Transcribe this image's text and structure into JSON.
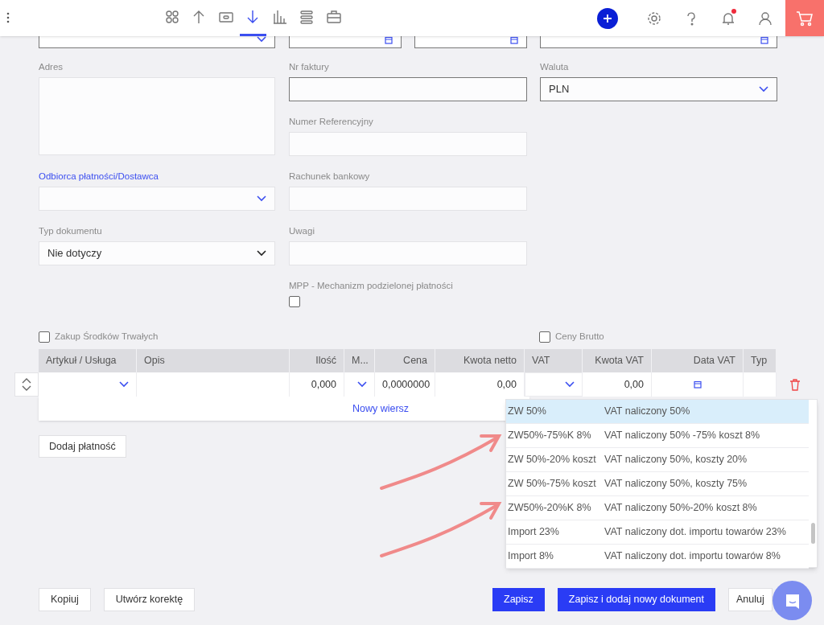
{
  "header": {
    "nav": [
      {
        "selected": false
      },
      {
        "selected": false
      },
      {
        "selected": false
      },
      {
        "selected": true
      },
      {
        "selected": false
      },
      {
        "selected": false
      },
      {
        "selected": false
      }
    ],
    "notification_unread": true
  },
  "top_fields": [
    {
      "kind": "select"
    },
    {
      "kind": "date"
    },
    {
      "kind": "date"
    },
    {
      "kind": "date"
    }
  ],
  "columns": [
    [
      {
        "kind": "textarea",
        "label": "Adres",
        "highlighted": false
      },
      {
        "kind": "select",
        "label": "Odbiorca płatności/Dostawca",
        "highlighted": true
      },
      {
        "kind": "native-select",
        "label": "Typ dokumentu",
        "highlighted": false,
        "value": "Nie dotyczy"
      }
    ],
    [
      {
        "kind": "text",
        "label": "Nr faktury",
        "highlighted": false,
        "outlined": true
      },
      {
        "kind": "text",
        "label": "Numer Referencyjny",
        "highlighted": false,
        "outlined": false
      },
      {
        "kind": "text",
        "label": "Rachunek bankowy",
        "highlighted": false,
        "outlined": false
      },
      {
        "kind": "text",
        "label": "Uwagi",
        "highlighted": false,
        "outlined": false
      },
      {
        "kind": "checkbox",
        "label": "MPP - Mechanizm podzielonej płatności",
        "highlighted": false,
        "checked": false
      }
    ],
    [
      {
        "kind": "select",
        "label": "Waluta",
        "highlighted": false,
        "value": "PLN",
        "outlined": true
      }
    ]
  ],
  "options": [
    {
      "label": "Zakup Środków Trwałych",
      "checked": false
    },
    {
      "label": "Ceny Brutto",
      "checked": false
    }
  ],
  "table": {
    "columns": [
      "Artykuł / Usługa",
      "Opis",
      "Ilość",
      "M...",
      "Cena",
      "Kwota netto",
      "VAT",
      "Kwota VAT",
      "Data VAT",
      "Typ"
    ],
    "rows": [
      {
        "cells": [
          "",
          "",
          "0,000",
          "",
          "0,0000000",
          "0,00",
          "",
          "0,00",
          "",
          ""
        ]
      }
    ],
    "add_row": "Nowy wiersz"
  },
  "vat_dropdown": [
    {
      "code": "ZW 50%",
      "description": "VAT naliczony 50%",
      "selected": true
    },
    {
      "code": "ZW50%-75%K 8%",
      "description": "VAT naliczony 50% -75% koszt 8%",
      "selected": false
    },
    {
      "code": "ZW 50%-20% koszt",
      "description": "VAT naliczony 50%, koszty 20%",
      "selected": false
    },
    {
      "code": "ZW 50%-75% koszt",
      "description": "VAT naliczony 50%, koszty 75%",
      "selected": false
    },
    {
      "code": "ZW50%-20%K 8%",
      "description": "VAT naliczony 50%-20% koszt 8%",
      "selected": false
    },
    {
      "code": "Import 23%",
      "description": "VAT naliczony dot. importu towarów 23%",
      "selected": false
    },
    {
      "code": "Import 8%",
      "description": "VAT naliczony dot. importu towarów 8%",
      "selected": false
    }
  ],
  "add_payment": "Dodaj płatność",
  "footer": {
    "left": [
      "Kopiuj",
      "Utwórz korektę"
    ],
    "right": [
      {
        "label": "Zapisz",
        "primary": true
      },
      {
        "label": "Zapisz i dodaj nowy dokument",
        "primary": true
      },
      {
        "label": "Anuluj",
        "primary": false
      }
    ]
  }
}
